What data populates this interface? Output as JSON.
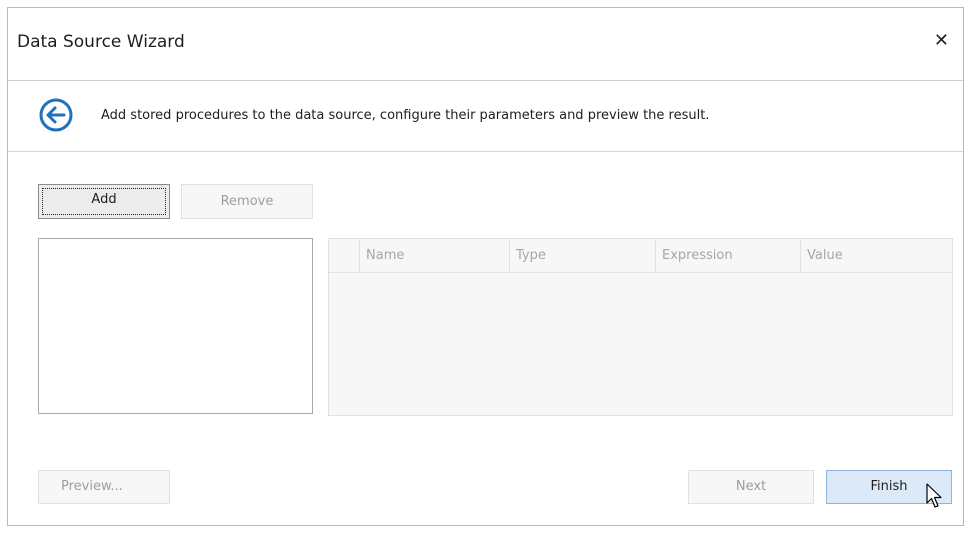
{
  "window": {
    "title": "Data Source Wizard"
  },
  "header": {
    "instruction": "Add stored procedures to the data source, configure their parameters and preview the result."
  },
  "toolbar": {
    "add_label": "Add",
    "remove_label": "Remove"
  },
  "grid": {
    "columns": [
      "Name",
      "Type",
      "Expression",
      "Value"
    ]
  },
  "footer": {
    "preview_label": "Preview...",
    "next_label": "Next",
    "finish_label": "Finish"
  },
  "colors": {
    "accent": "#1e73be",
    "finish_bg": "#dce9f8"
  },
  "icons": {
    "back": "back-arrow-circle-icon",
    "close": "close-icon",
    "cursor": "mouse-pointer-icon"
  }
}
